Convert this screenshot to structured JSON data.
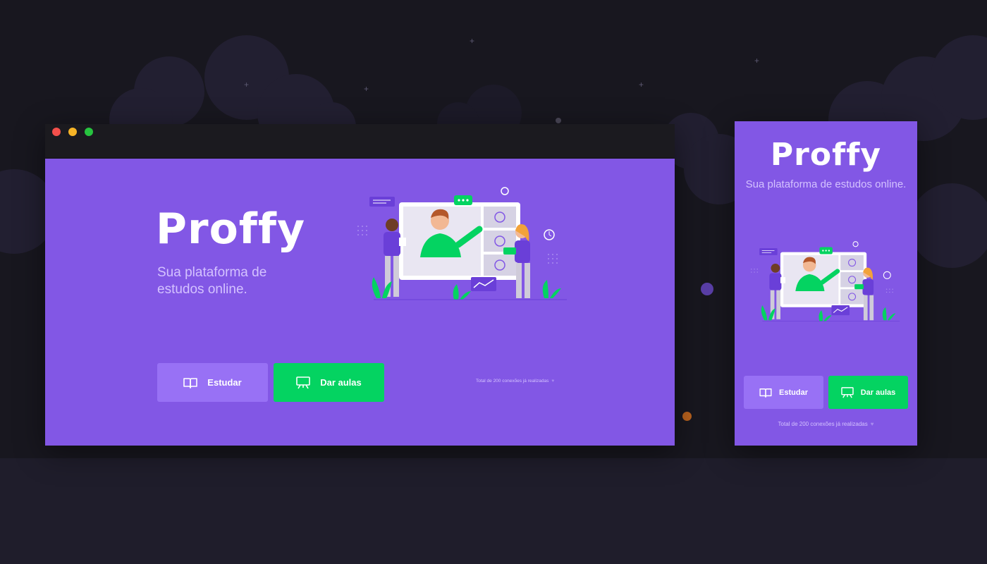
{
  "app": {
    "logo": "Proffy",
    "tagline": "Sua plataforma de estudos online."
  },
  "buttons": {
    "study_label": "Estudar",
    "teach_label": "Dar aulas"
  },
  "connections": {
    "text": "Total de 200 conexões já realizadas"
  },
  "colors": {
    "background_dark": "#18171f",
    "primary": "#8257e5",
    "primary_light": "#9871f5",
    "secondary": "#04d361",
    "text_light": "#d4c2ff"
  },
  "icons": {
    "study": "book-open-icon",
    "teach": "presentation-board-icon",
    "connections": "heart-icon"
  }
}
